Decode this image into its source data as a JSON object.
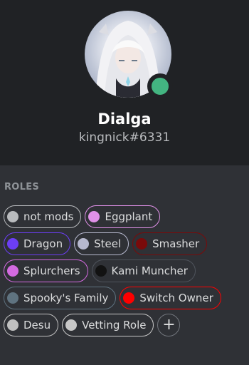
{
  "profile": {
    "display_name": "Dialga",
    "tag": "kingnick#6331",
    "status_color": "#43b581"
  },
  "roles_section": {
    "title": "ROLES",
    "add_icon": "plus-icon",
    "add_symbol": "+"
  },
  "roles": [
    {
      "label": "not mods",
      "color": "#b9bbbe"
    },
    {
      "label": "Eggplant",
      "color": "#e091e8"
    },
    {
      "label": "Dragon",
      "color": "#6c3ef5"
    },
    {
      "label": "Steel",
      "color": "#b7b9cf"
    },
    {
      "label": "Smasher",
      "color": "#7a0a0a"
    },
    {
      "label": "Splurchers",
      "color": "#d36ae0"
    },
    {
      "label": "Kami Muncher",
      "color": "#121212"
    },
    {
      "label": "Spooky's Family",
      "color": "#5f7380"
    },
    {
      "label": "Switch Owner",
      "color": "#ff0000"
    },
    {
      "label": "Desu",
      "color": "#c0c0c0"
    },
    {
      "label": "Vetting Role",
      "color": "#c8c8c8"
    }
  ]
}
